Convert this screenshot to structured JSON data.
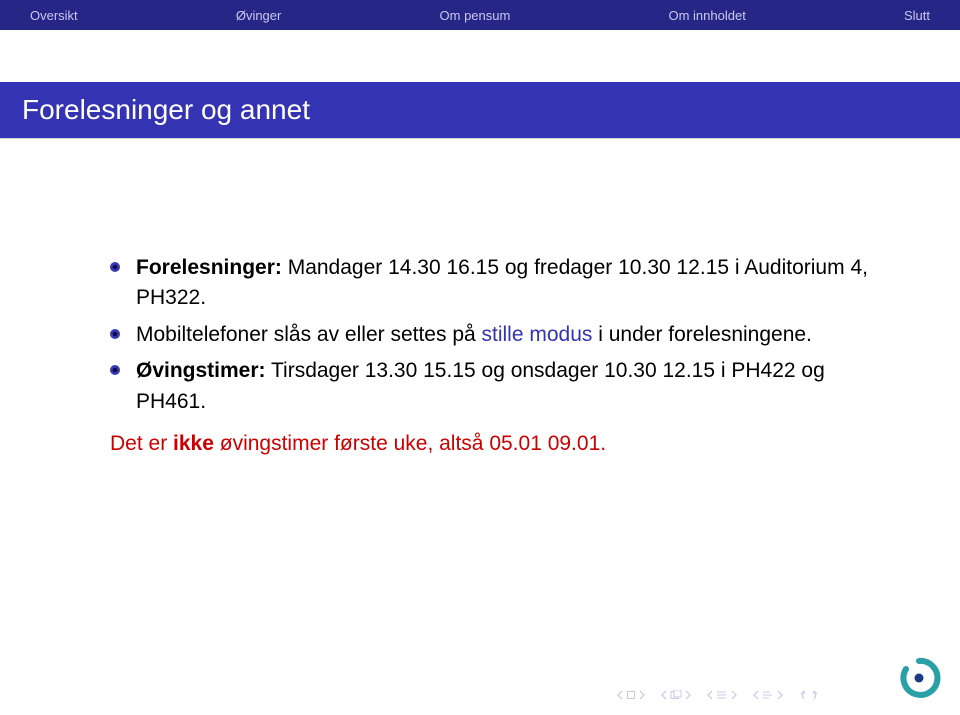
{
  "nav": {
    "items": [
      "Oversikt",
      "Øvinger",
      "Om pensum",
      "Om innholdet",
      "Slutt"
    ]
  },
  "title": "Forelesninger og annet",
  "bullets": [
    {
      "prefix": "Forelesninger:",
      "text": " Mandager 14.30 16.15 og fredager 10.30 12.15 i Auditorium 4, PH322."
    },
    {
      "lead": "Mobiltelefoner slås av eller settes på ",
      "emph": "stille modus",
      "tail": " i under forelesningene."
    },
    {
      "prefix": "Øvingstimer:",
      "text": " Tirsdager 13.30 15.15 og onsdager 10.30 12.15 i PH422 og PH461."
    }
  ],
  "note": {
    "lead": "Det er ",
    "emph": "ikke",
    "tail": " øvingstimer første uke, altså 05.01 09.01."
  },
  "colors": {
    "navbar": "#262686",
    "band": "#3333b3",
    "red": "#cc0000"
  }
}
